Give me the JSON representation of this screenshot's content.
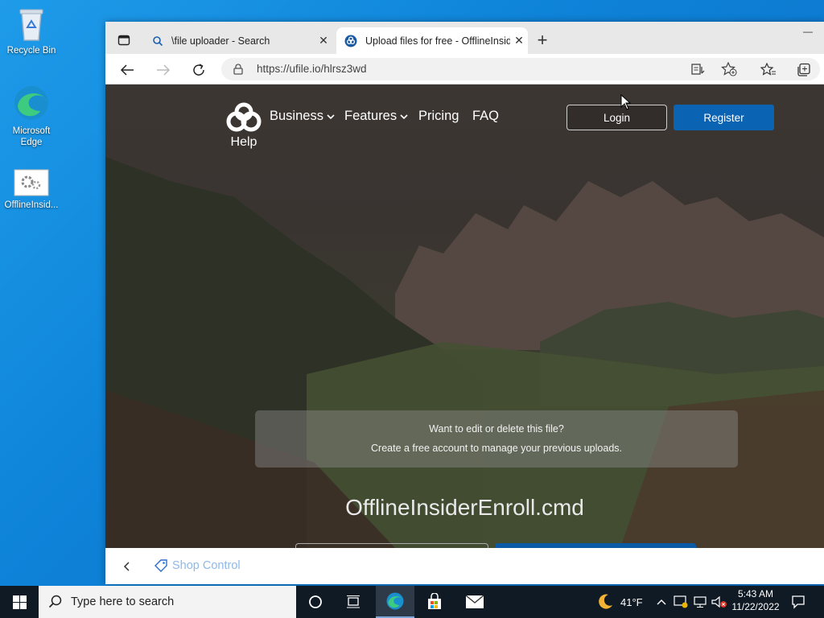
{
  "desktop": {
    "icons": [
      {
        "label": "Recycle Bin"
      },
      {
        "label": "Microsoft Edge"
      },
      {
        "label": "OfflineInsid..."
      }
    ]
  },
  "browser": {
    "tabs": [
      {
        "title": "\\file uploader - Search",
        "close": "✕"
      },
      {
        "title": "Upload files for free - OfflineInsid",
        "close": "✕"
      }
    ],
    "new_tab": "+",
    "window_minimize": "—",
    "url": "https://ufile.io/hlrsz3wd"
  },
  "page": {
    "nav": {
      "logo_label": "Help",
      "items": [
        {
          "label": "Business"
        },
        {
          "label": "Features"
        },
        {
          "label": "Pricing"
        },
        {
          "label": "FAQ"
        }
      ],
      "login_label": "Login",
      "register_label": "Register"
    },
    "notice": {
      "line1": "Want to edit or delete this file?",
      "line2": "Create a free account to manage your previous uploads."
    },
    "filename": "OfflineInsiderEnroll.cmd"
  },
  "shopbar": {
    "label": "Shop Control"
  },
  "taskbar": {
    "search_placeholder": "Type here to search",
    "weather": "41°F",
    "time": "5:43 AM",
    "date": "11/22/2022"
  },
  "colors": {
    "accent_register": "#0b63b4",
    "desktop_blue": "#0e83d8",
    "taskbar": "#101a25"
  }
}
